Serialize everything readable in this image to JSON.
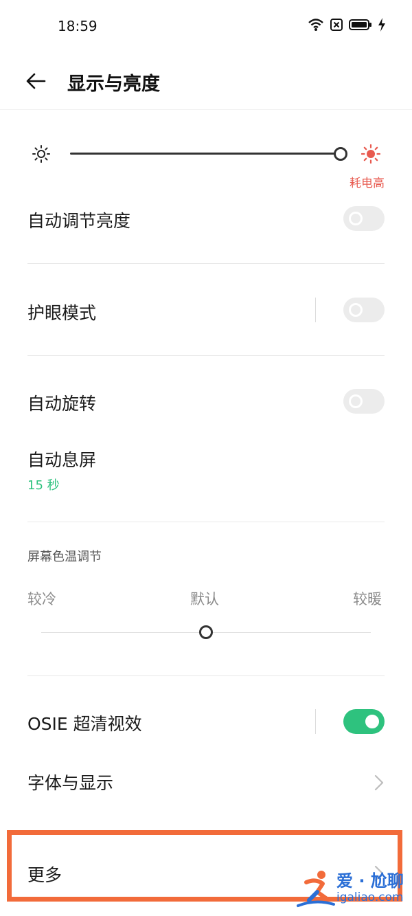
{
  "status_bar": {
    "time": "18:59",
    "icons": [
      "wifi-icon",
      "sim-off-icon",
      "battery-icon",
      "charging-icon"
    ]
  },
  "header": {
    "back_icon": "arrow-left-icon",
    "title": "显示与亮度"
  },
  "brightness": {
    "level": 1.0,
    "low_icon": "sun-outline-icon",
    "high_icon": "sun-filled-icon",
    "warning": "耗电高",
    "warning_color": "#e85a4f"
  },
  "settings": {
    "auto_brightness": {
      "label": "自动调节亮度",
      "enabled": false
    },
    "eye_care": {
      "label": "护眼模式",
      "enabled": false
    },
    "auto_rotate": {
      "label": "自动旋转",
      "enabled": false
    },
    "screen_timeout": {
      "label": "自动息屏",
      "value": "15 秒"
    },
    "color_temperature": {
      "title": "屏幕色温调节",
      "cold_label": "较冷",
      "default_label": "默认",
      "warm_label": "较暖",
      "level": 0.5
    },
    "osie": {
      "label": "OSIE 超清视效",
      "enabled": true
    },
    "font_display": {
      "label": "字体与显示"
    },
    "more": {
      "label": "更多"
    }
  },
  "colors": {
    "accent": "#2ec27e",
    "highlight": "#f26b3a",
    "watermark": "#2b6fd6"
  },
  "watermark": {
    "title": "爱 · 尬聊",
    "url": "igaliao.com"
  }
}
